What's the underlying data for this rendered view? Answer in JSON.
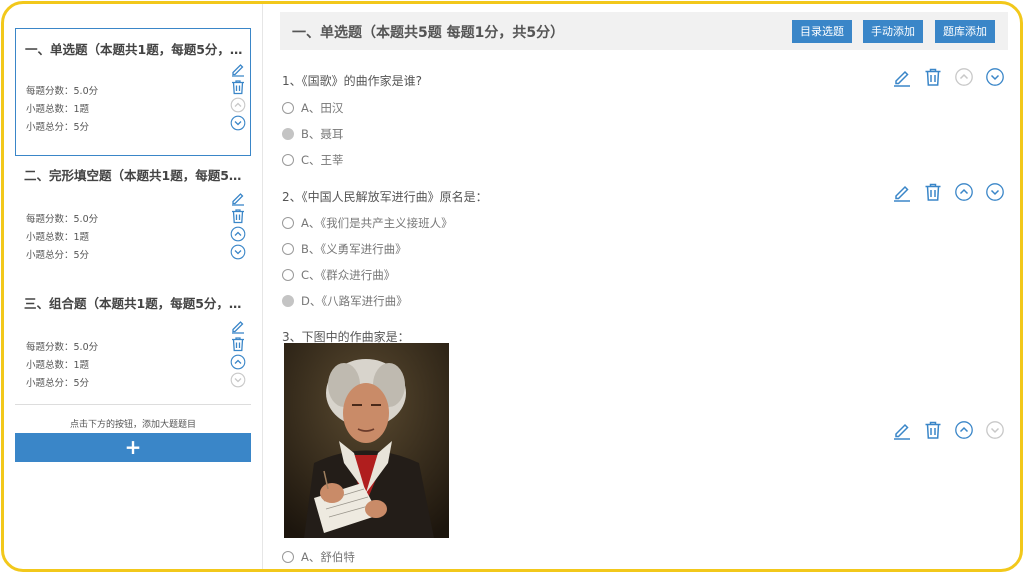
{
  "colors": {
    "accent": "#3a86c8",
    "frame": "#f2c81b"
  },
  "sidebar": {
    "sections": [
      {
        "title": "一、单选题（本题共1题，每题5分，…",
        "score": "每题分数：5.0分",
        "count": "小题总数：1题",
        "total": "小题总分：5分"
      },
      {
        "title": "二、完形填空题（本题共1题，每题5.…",
        "score": "每题分数：5.0分",
        "count": "小题总数：1题",
        "total": "小题总分：5分"
      },
      {
        "title": "三、组合题（本题共1题，每题5分，…",
        "score": "每题分数：5.0分",
        "count": "小题总数：1题",
        "total": "小题总分：5分"
      }
    ],
    "hint": "点击下方的按钮，添加大题题目",
    "add_label": "+"
  },
  "main": {
    "header_title": "一、单选题（本题共5题 每题1分，共5分）",
    "buttons": {
      "catalog": "目录选题",
      "manual": "手动添加",
      "bank": "题库添加"
    },
    "questions": [
      {
        "text": "1、《国歌》的曲作家是谁?",
        "options": [
          "A、田汉",
          "B、聂耳",
          "C、王莘"
        ]
      },
      {
        "text": "2、《中国人民解放军进行曲》原名是：",
        "options": [
          "A、《我们是共产主义接班人》",
          "B、《义勇军进行曲》",
          "C、《群众进行曲》",
          "D、《八路军进行曲》"
        ]
      },
      {
        "text": "3、下图中的作曲家是：",
        "options": [
          "A、舒伯特"
        ]
      }
    ]
  }
}
